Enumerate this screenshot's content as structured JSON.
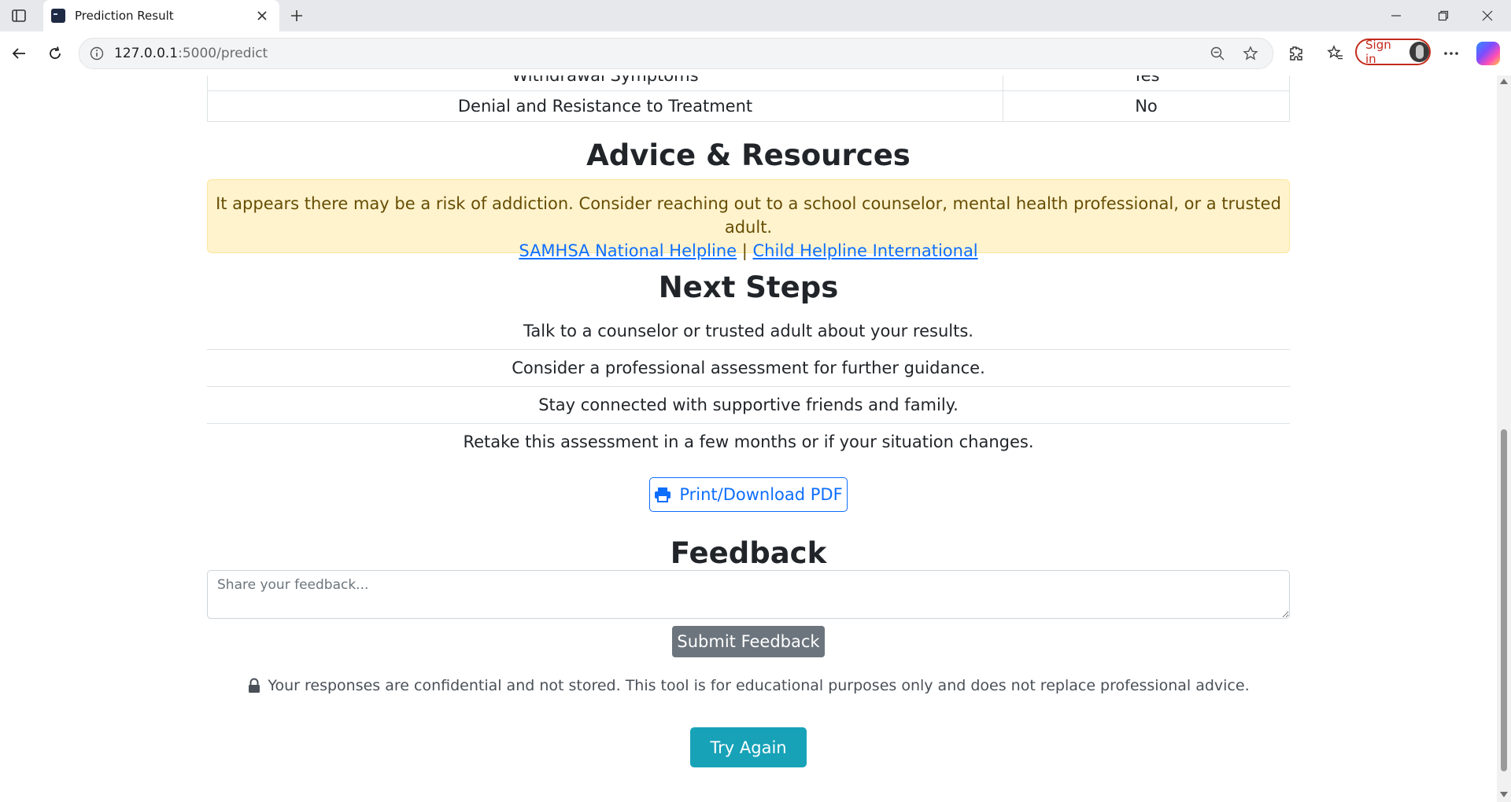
{
  "browser": {
    "tab_title": "Prediction Result",
    "url_host": "127.0.0.1",
    "url_path": ":5000/predict",
    "signin_label": "Sign in"
  },
  "symptoms_table": {
    "rows": [
      {
        "symptom": "Withdrawal Symptoms",
        "value": "Yes"
      },
      {
        "symptom": "Denial and Resistance to Treatment",
        "value": "No"
      }
    ]
  },
  "advice": {
    "heading": "Advice & Resources",
    "message": "It appears there may be a risk of addiction. Consider reaching out to a school counselor, mental health professional, or a trusted adult.",
    "link1": "SAMHSA National Helpline",
    "separator": "|",
    "link2": "Child Helpline International"
  },
  "next_steps": {
    "heading": "Next Steps",
    "items": [
      "Talk to a counselor or trusted adult about your results.",
      "Consider a professional assessment for further guidance.",
      "Stay connected with supportive friends and family.",
      "Retake this assessment in a few months or if your situation changes."
    ]
  },
  "print_button": "Print/Download PDF",
  "feedback": {
    "heading": "Feedback",
    "placeholder": "Share your feedback...",
    "submit_label": "Submit Feedback"
  },
  "disclaimer": "Your responses are confidential and not stored. This tool is for educational purposes only and does not replace professional advice.",
  "try_again_label": "Try Again",
  "colors": {
    "alert_bg": "#fff3cd",
    "primary": "#0d6efd",
    "secondary": "#6c757d",
    "info": "#17a2b8"
  }
}
